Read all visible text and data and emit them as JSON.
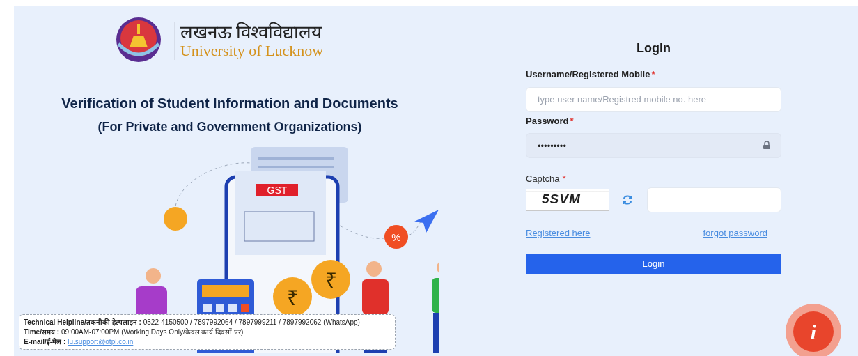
{
  "header": {
    "hindi_name": "लखनऊ विश्वविद्यालय",
    "english_name": "University of Lucknow"
  },
  "headline": "Verification of Student Information and Documents",
  "subheadline": "(For Private and Government Organizations)",
  "illustration": {
    "badge": "GST",
    "coin_symbol": "₹",
    "percent": "%"
  },
  "login": {
    "title": "Login",
    "fields": [
      {
        "kind": "text",
        "label": "Username/Registered Mobile",
        "required": "*",
        "placeholder": "type user name/Registred mobile no. here"
      },
      {
        "kind": "password",
        "label": "Password",
        "required": "*",
        "value": "•••••••••"
      }
    ],
    "captcha": {
      "label": "Captcha",
      "required": "*",
      "code": "5SVM"
    },
    "links": [
      "Registered here",
      "forgot password"
    ],
    "button": "Login"
  },
  "helpline": [
    {
      "kind": "text",
      "label": "Technical Helpline/तकनीकी हेल्पलाइन :",
      "value": "0522-4150500 / 7897992064 / 7897999211 / 7897992062 (WhatsApp)"
    },
    {
      "kind": "text",
      "label": "Time/समय :",
      "value": "09:00AM-07:00PM (Working Days Only/केवल कार्य दिवसों पर)"
    },
    {
      "kind": "link",
      "label": "E-mail/ई-मेल :",
      "value": "lu.support@otpl.co.in"
    }
  ],
  "info_button": "i"
}
